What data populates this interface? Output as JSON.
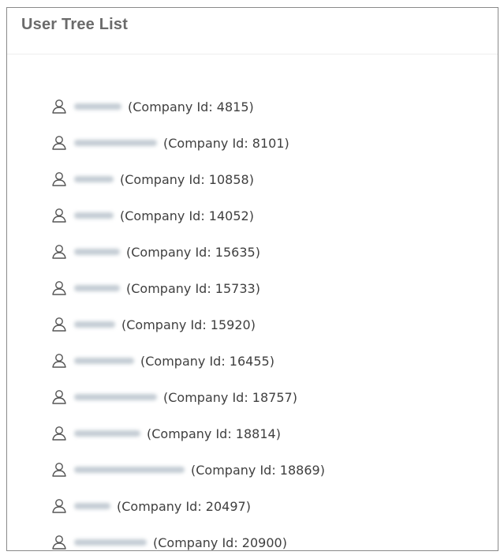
{
  "panel": {
    "title": "User Tree List"
  },
  "items": [
    {
      "label": "(Company Id: 4815)"
    },
    {
      "label": "(Company Id: 8101)"
    },
    {
      "label": "(Company Id: 10858)"
    },
    {
      "label": "(Company Id: 14052)"
    },
    {
      "label": "(Company Id: 15635)"
    },
    {
      "label": "(Company Id: 15733)"
    },
    {
      "label": "(Company Id: 15920)"
    },
    {
      "label": "(Company Id: 16455)"
    },
    {
      "label": "(Company Id: 18757)"
    },
    {
      "label": "(Company Id: 18814)"
    },
    {
      "label": "(Company Id: 18869)"
    },
    {
      "label": "(Company Id: 20497)"
    },
    {
      "label": "(Company Id: 20900)"
    }
  ],
  "icons": {
    "item_icon": "user-icon"
  }
}
